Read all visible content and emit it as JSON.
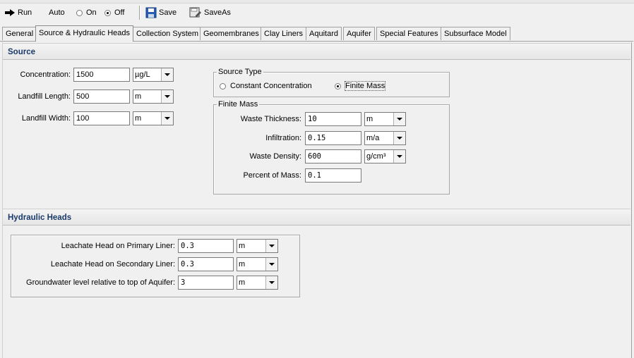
{
  "toolbar": {
    "run_label": "Run",
    "auto_label": "Auto",
    "on_label": "On",
    "off_label": "Off",
    "save_label": "Save",
    "saveas_label": "SaveAs"
  },
  "tabs": [
    {
      "label": "General"
    },
    {
      "label": "Source & Hydraulic Heads"
    },
    {
      "label": "Collection System"
    },
    {
      "label": "Geomembranes"
    },
    {
      "label": "Clay Liners"
    },
    {
      "label": "Aquitard"
    },
    {
      "label": "Aquifer"
    },
    {
      "label": "Special Features"
    },
    {
      "label": "Subsurface Model"
    }
  ],
  "source": {
    "header": "Source",
    "concentration": {
      "label": "Concentration:",
      "value": "1500",
      "unit": "µg/L"
    },
    "landfill_length": {
      "label": "Landfill Length:",
      "value": "500",
      "unit": "m"
    },
    "landfill_width": {
      "label": "Landfill Width:",
      "value": "100",
      "unit": "m"
    },
    "source_type": {
      "title": "Source Type",
      "constant_label": "Constant Concentration",
      "finite_label": "Finite Mass"
    },
    "finite_mass": {
      "title": "Finite Mass",
      "waste_thickness": {
        "label": "Waste Thickness:",
        "value": "10",
        "unit": "m"
      },
      "infiltration": {
        "label": "Infiltration:",
        "value": "0.15",
        "unit": "m/a"
      },
      "waste_density": {
        "label": "Waste Density:",
        "value": "600",
        "unit": "g/cm³"
      },
      "percent_mass": {
        "label": "Percent of Mass:",
        "value": "0.1"
      }
    }
  },
  "hydraulic": {
    "header": "Hydraulic Heads",
    "primary": {
      "label": "Leachate Head on Primary Liner:",
      "value": "0.3",
      "unit": "m"
    },
    "secondary": {
      "label": "Leachate Head on Secondary Liner:",
      "value": "0.3",
      "unit": "m"
    },
    "groundwater": {
      "label": "Groundwater level relative to top of Aquifer:",
      "value": "3",
      "unit": "m"
    }
  }
}
